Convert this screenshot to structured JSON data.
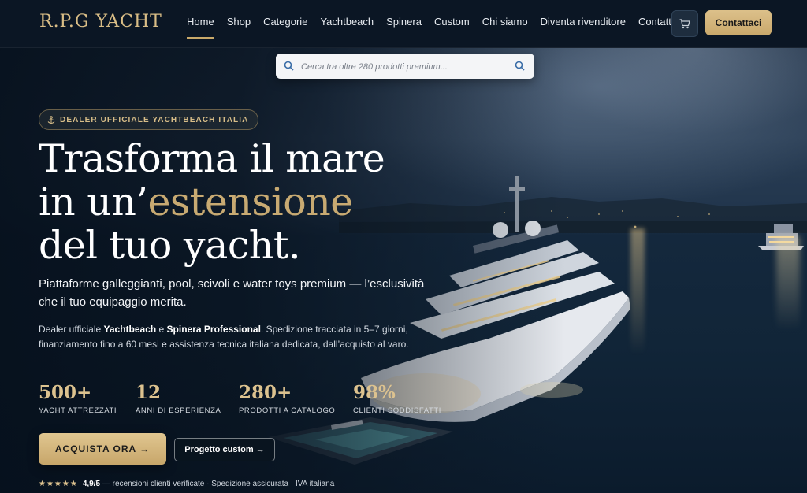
{
  "brand": {
    "logo": "R.P.G YACHT"
  },
  "nav": {
    "items": [
      {
        "label": "Home",
        "active": true
      },
      {
        "label": "Shop"
      },
      {
        "label": "Categorie"
      },
      {
        "label": "Yachtbeach"
      },
      {
        "label": "Spinera"
      },
      {
        "label": "Custom"
      },
      {
        "label": "Chi siamo"
      },
      {
        "label": "Diventa rivenditore"
      },
      {
        "label": "Contattaci"
      }
    ],
    "cart_icon": "cart-icon",
    "cta_label": "Contattaci"
  },
  "search": {
    "placeholder": "Cerca tra oltre 280 prodotti premium..."
  },
  "hero": {
    "badge": "DEALER UFFICIALE YACHTBEACH ITALIA",
    "headline_1": "Trasforma il mare",
    "headline_2a": "in un’",
    "headline_2b": "estensione",
    "headline_3": "del tuo yacht.",
    "lead": "Piattaforme galleggianti, pool, scivoli e water toys premium — l’esclusività che il tuo equipaggio merita.",
    "desc_1": "Dealer ufficiale ",
    "desc_brand_1": "Yachtbeach",
    "desc_2": " e ",
    "desc_brand_2": "Spinera Professional",
    "desc_3": ". Spedizione tracciata in 5–7 giorni, finanziamento fino a 60 mesi e assistenza tecnica italiana dedicata, dall’acquisto al varo.",
    "stats": [
      {
        "value": "500+",
        "label": "YACHT ATTREZZATI"
      },
      {
        "value": "12",
        "label": "ANNI DI ESPERIENZA"
      },
      {
        "value": "280+",
        "label": "PRODOTTI A CATALOGO"
      },
      {
        "value": "98%",
        "label": "CLIENTI SODDISFATTI"
      }
    ],
    "primary_button": "ACQUISTA ORA →",
    "secondary_button": "Progetto custom →",
    "trust": {
      "stars": "★★★★★",
      "rating": "4,9/5",
      "text": " — recensioni clienti verificate · Spedizione assicurata · IVA italiana"
    }
  },
  "colors": {
    "gold": "#c9a96a",
    "nav_bg": "#0b1624",
    "text": "#ffffff"
  }
}
